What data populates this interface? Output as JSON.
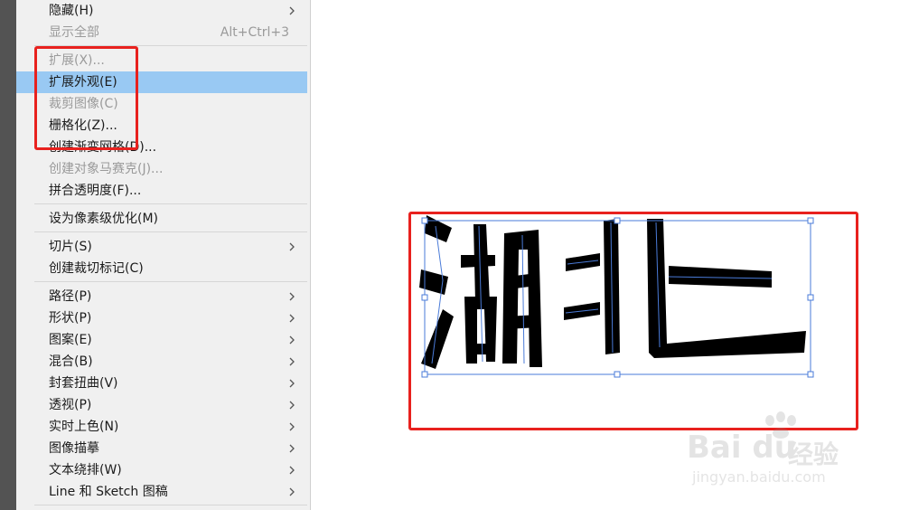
{
  "menu": {
    "items": [
      {
        "label": "隐藏(H)",
        "disabled": false,
        "submenu": true
      },
      {
        "label": "显示全部",
        "disabled": true,
        "shortcut": "Alt+Ctrl+3"
      },
      {
        "label": "扩展(X)...",
        "disabled": true
      },
      {
        "label": "扩展外观(E)",
        "disabled": false,
        "highlighted": true
      },
      {
        "label": "裁剪图像(C)",
        "disabled": true
      },
      {
        "label": "栅格化(Z)...",
        "disabled": false
      },
      {
        "label": "创建渐变网格(D)...",
        "disabled": false
      },
      {
        "label": "创建对象马赛克(J)...",
        "disabled": true
      },
      {
        "label": "拼合透明度(F)...",
        "disabled": false
      },
      {
        "label": "设为像素级优化(M)",
        "disabled": false
      },
      {
        "label": "切片(S)",
        "disabled": false,
        "submenu": true
      },
      {
        "label": "创建裁切标记(C)",
        "disabled": false
      },
      {
        "label": "路径(P)",
        "disabled": false,
        "submenu": true
      },
      {
        "label": "形状(P)",
        "disabled": false,
        "submenu": true
      },
      {
        "label": "图案(E)",
        "disabled": false,
        "submenu": true
      },
      {
        "label": "混合(B)",
        "disabled": false,
        "submenu": true
      },
      {
        "label": "封套扭曲(V)",
        "disabled": false,
        "submenu": true
      },
      {
        "label": "透视(P)",
        "disabled": false,
        "submenu": true
      },
      {
        "label": "实时上色(N)",
        "disabled": false,
        "submenu": true
      },
      {
        "label": "图像描摹",
        "disabled": false,
        "submenu": true
      },
      {
        "label": "文本绕排(W)",
        "disabled": false,
        "submenu": true
      },
      {
        "label": "Line 和 Sketch 图稿",
        "disabled": false,
        "submenu": true
      }
    ]
  },
  "canvas": {
    "artwork_text": "湖北"
  },
  "watermark": {
    "brand": "Bai du",
    "cn": "经验",
    "url": "jingyan.baidu.com"
  },
  "colors": {
    "highlight": "#99c9f3",
    "annotation_red": "#e8211e",
    "selection_blue": "#4a7bd8"
  }
}
